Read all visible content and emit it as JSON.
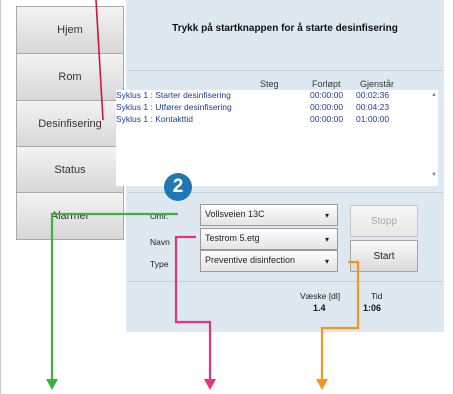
{
  "sidebar": {
    "items": [
      {
        "label": "Hjem"
      },
      {
        "label": "Rom"
      },
      {
        "label": "Desinfisering"
      },
      {
        "label": "Status"
      },
      {
        "label": "Alarmer"
      }
    ]
  },
  "main": {
    "title": "Trykk på startknappen for å starte desinfisering",
    "log": {
      "columns": [
        "Steg",
        "Forløpt",
        "Gjenstår"
      ],
      "rows": [
        {
          "step": "Syklus 1 : Starter desinfisering",
          "elapsed": "00:00:00",
          "remaining": "00:02:36"
        },
        {
          "step": "Syklus 1 : Utfører desinfisering",
          "elapsed": "00:00:00",
          "remaining": "00:04:23"
        },
        {
          "step": "Syklus 1 : Kontakttid",
          "elapsed": "00:00:00",
          "remaining": "01:00:00"
        }
      ]
    },
    "form": {
      "area_label": "Omr.",
      "area_value": "Vollsveien 13C",
      "name_label": "Navn",
      "name_value": "Testrom 5.etg",
      "type_label": "Type",
      "type_value": "Preventive disinfection"
    },
    "buttons": {
      "stop": "Stopp",
      "start": "Start"
    },
    "stats": {
      "liquid_label": "Væske [dl]",
      "liquid_value": "1.4",
      "time_label": "Tid",
      "time_value": "1:06"
    }
  },
  "annotations": {
    "badge": "2",
    "colors": {
      "green": "#3cb43c",
      "pink": "#e8327c",
      "orange": "#f7941d",
      "red": "#d1163b",
      "badge": "#1f78b4"
    }
  }
}
